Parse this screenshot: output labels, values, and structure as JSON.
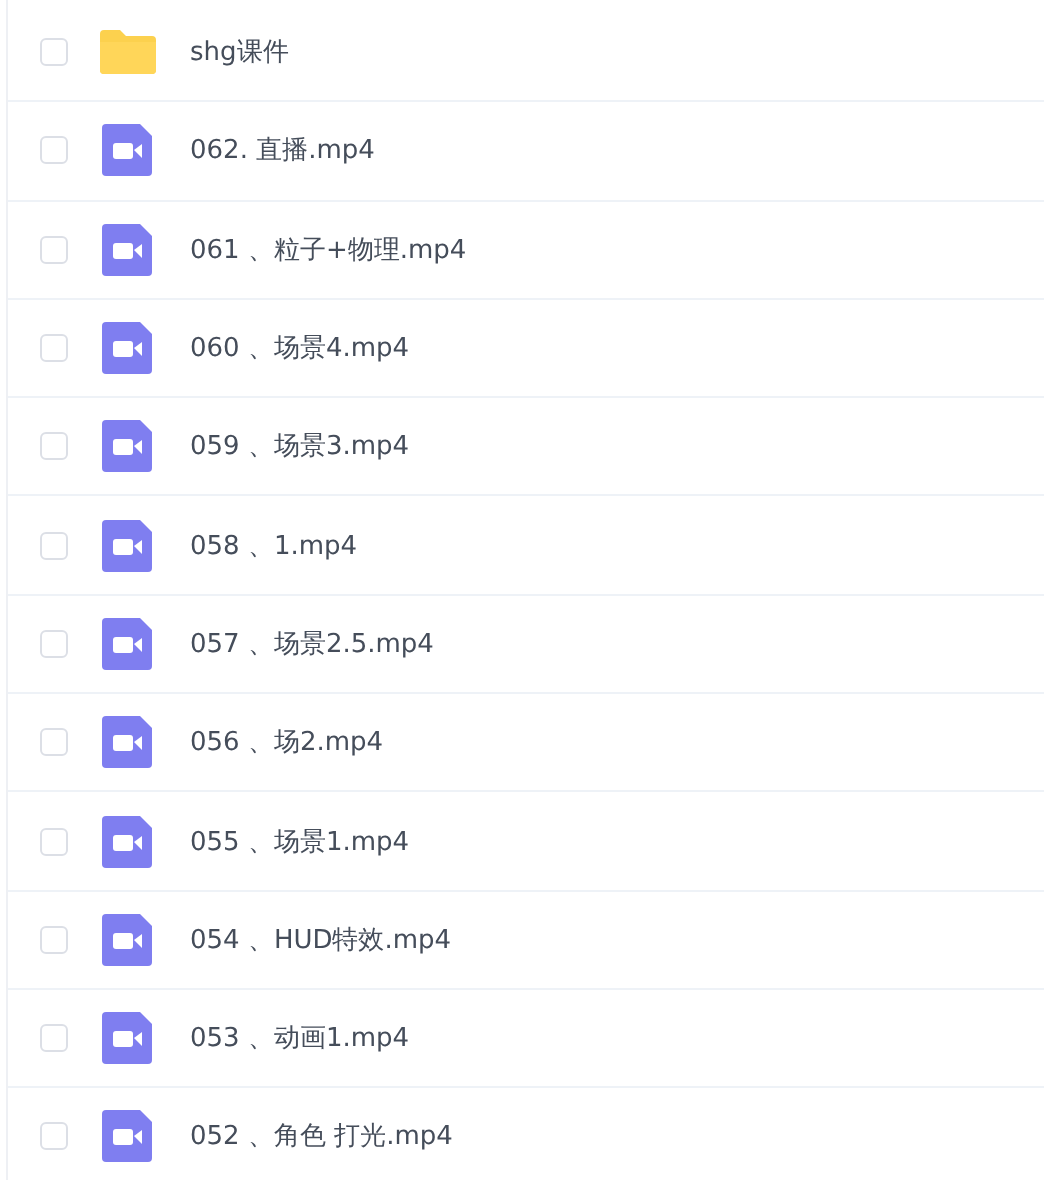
{
  "files": [
    {
      "kind": "folder",
      "name": "shg课件",
      "checked": false
    },
    {
      "kind": "video",
      "name": "062. 直播.mp4",
      "checked": false
    },
    {
      "kind": "video",
      "name": "061 、粒子+物理.mp4",
      "checked": false
    },
    {
      "kind": "video",
      "name": "060 、场景4.mp4",
      "checked": false
    },
    {
      "kind": "video",
      "name": "059 、场景3.mp4",
      "checked": false
    },
    {
      "kind": "video",
      "name": "058 、1.mp4",
      "checked": false
    },
    {
      "kind": "video",
      "name": "057 、场景2.5.mp4",
      "checked": false
    },
    {
      "kind": "video",
      "name": "056 、场2.mp4",
      "checked": false
    },
    {
      "kind": "video",
      "name": "055 、场景1.mp4",
      "checked": false
    },
    {
      "kind": "video",
      "name": "054 、HUD特效.mp4",
      "checked": false
    },
    {
      "kind": "video",
      "name": "053 、动画1.mp4",
      "checked": false
    },
    {
      "kind": "video",
      "name": "052 、角色 打光.mp4",
      "checked": false
    }
  ]
}
